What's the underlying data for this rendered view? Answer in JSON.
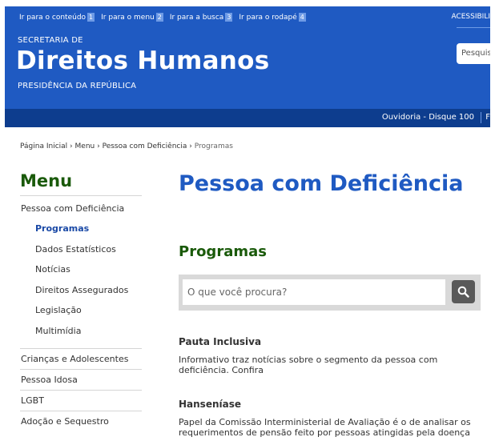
{
  "header": {
    "skip_links": [
      {
        "label": "Ir para o conteúdo",
        "key": "1"
      },
      {
        "label": "Ir para o menu",
        "key": "2"
      },
      {
        "label": "Ir para a busca",
        "key": "3"
      },
      {
        "label": "Ir para o rodapé",
        "key": "4"
      }
    ],
    "accessibility": "ACESSIBILI",
    "org_sub": "SECRETARIA DE",
    "org_title": "Direitos Humanos",
    "org_parent": "PRESIDÊNCIA DA REPÚBLICA",
    "search_placeholder": "Pesquis",
    "ouvidoria": "Ouvidoria - Disque 100",
    "trunc_link": "F",
    "colors": {
      "brand": "#1f5ac2",
      "servicebar": "#0d3d8e"
    }
  },
  "breadcrumb": {
    "items": [
      "Página Inicial",
      "Menu",
      "Pessoa com Deficiência"
    ],
    "separator": "›",
    "current": "Programas"
  },
  "sidebar": {
    "title": "Menu",
    "section": "Pessoa com Deficiência",
    "subitems": [
      "Programas",
      "Dados Estatísticos",
      "Notícias",
      "Direitos Assegurados",
      "Legislação",
      "Multimídia"
    ],
    "items": [
      "Crianças e Adolescentes",
      "Pessoa Idosa",
      "LGBT",
      "Adoção e Sequestro"
    ]
  },
  "main": {
    "page_title": "Pessoa com Deficiência",
    "section_title": "Programas",
    "search_placeholder": "O que você procura?",
    "search_icon": "search-icon",
    "posts": [
      {
        "title": "Pauta Inclusiva",
        "text": "Informativo traz notícias sobre o segmento da pessoa com deficiência. Confira"
      },
      {
        "title": "Hanseníase",
        "text": "Papel da Comissão Interministerial de Avaliação é o de analisar os requerimentos de pensão feito por pessoas atingidas pela doença"
      }
    ]
  }
}
